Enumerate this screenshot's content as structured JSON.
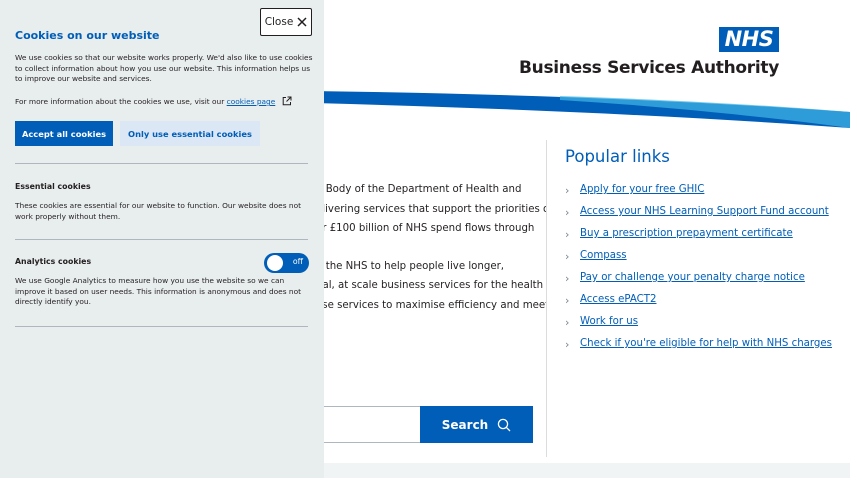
{
  "header": {
    "logo_text": "NHS",
    "org_name": "Business Services Authority",
    "brand_color": "#005eb8"
  },
  "intro": {
    "paragraph1": [
      "n Body of the Department of Health and",
      "elivering services that support the priorities of",
      "er £100 billion of NHS spend flows through"
    ],
    "paragraph2": [
      "p the NHS to help people live longer,",
      "nal, at scale business services for the health",
      "ese services to maximise efficiency and meet"
    ]
  },
  "search": {
    "button_label": "Search",
    "icon": "search-icon"
  },
  "popular_links": {
    "heading": "Popular links",
    "items": [
      "Apply for your free GHIC",
      "Access your NHS Learning Support Fund account",
      "Buy a prescription prepayment certificate",
      "Compass",
      "Pay or challenge your penalty charge notice",
      "Access ePACT2",
      "Work for us",
      "Check if you're eligible for help with NHS charges"
    ]
  },
  "cookie_banner": {
    "close_label": "Close",
    "title": "Cookies on our website",
    "description": "We use cookies so that our website works properly. We'd also like to use cookies to collect information about how you use our website. This information helps us to improve our website and services.",
    "more_info_prefix": "For more information about the cookies we use, visit our",
    "more_info_link": "cookies page",
    "accept_all_label": "Accept all cookies",
    "essential_only_label": "Only use essential cookies",
    "essential": {
      "title": "Essential cookies",
      "text": "These cookies are essential for our website to function. Our website does not work properly without them."
    },
    "analytics": {
      "title": "Analytics cookies",
      "text": "We use Google Analytics to measure how you use the website so we can improve it based on user needs. This information is anonymous and does not directly identify you.",
      "toggle_state": "off"
    },
    "panel_color": "#e8edee"
  }
}
